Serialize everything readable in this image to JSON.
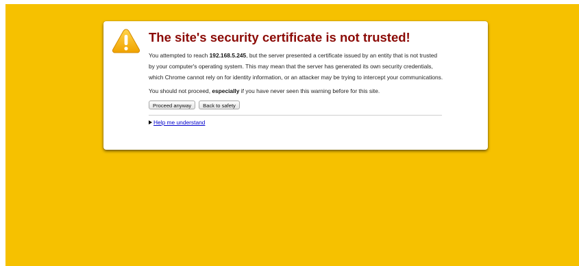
{
  "colors": {
    "page_background": "#f6c100",
    "title": "#8b0a06",
    "link": "#0000cc"
  },
  "interstitial": {
    "icon": "warning-triangle-icon",
    "title": "The site's security certificate is not trusted!",
    "para1_pre": "You attempted to reach ",
    "para1_host": "192.168.5.245",
    "para1_post": ", but the server presented a certificate issued by an entity that is not trusted by your computer's operating system. This may mean that the server has generated its own security credentials, which Chrome cannot rely on for identity information, or an attacker may be trying to intercept your communications.",
    "para2_pre": "You should not proceed, ",
    "para2_emph": "especially",
    "para2_post": " if you have never seen this warning before for this site.",
    "proceed_label": "Proceed anyway",
    "back_label": "Back to safety",
    "help_label": "Help me understand"
  }
}
